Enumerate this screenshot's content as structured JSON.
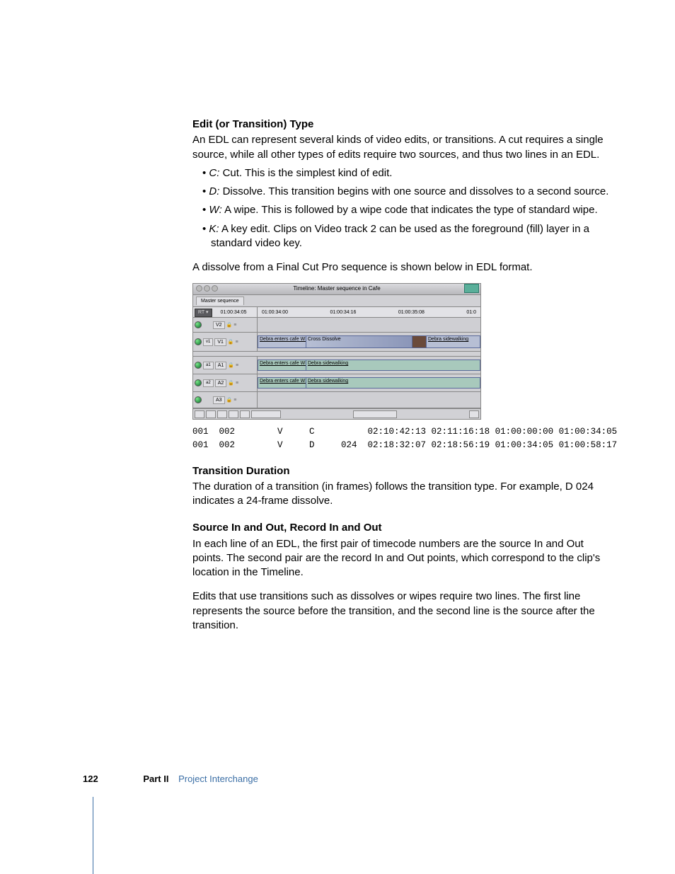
{
  "sections": {
    "editType": {
      "heading": "Edit (or Transition) Type",
      "intro": "An EDL can represent several kinds of video edits, or transitions. A cut requires a single source, while all other types of edits require two sources, and thus two lines in an EDL.",
      "items": [
        {
          "key": "C:",
          "body": "Cut. This is the simplest kind of edit."
        },
        {
          "key": "D:",
          "body": "Dissolve. This transition begins with one source and dissolves to a second source."
        },
        {
          "key": "W:",
          "body": "A wipe. This is followed by a wipe code that indicates the type of standard wipe."
        },
        {
          "key": "K:",
          "body": "A key edit. Clips on Video track 2 can be used as the foreground (fill) layer in a standard video key."
        }
      ],
      "afterList": "A dissolve from a Final Cut Pro sequence is shown below in EDL format."
    },
    "transitionDuration": {
      "heading": "Transition Duration",
      "body": "The duration of a transition (in frames) follows the transition type. For example, D 024 indicates a 24-frame dissolve."
    },
    "sourceIO": {
      "heading": "Source In and Out, Record In and Out",
      "body1": "In each line of an EDL, the first pair of timecode numbers are the source In and Out points. The second pair are the record In and Out points, which correspond to the clip's location in the Timeline.",
      "body2": "Edits that use transitions such as dissolves or wipes require two lines. The first line represents the source before the transition, and the second line is the source after the transition."
    }
  },
  "timeline": {
    "windowTitle": "Timeline: Master sequence in Cafe",
    "tab": "Master sequence",
    "rt": "RT ▾",
    "currentTime": "01:00:34:05",
    "rulerMarks": [
      "01:00:34:00",
      "01:00:34:16",
      "01:00:35:08",
      "01:0"
    ],
    "tracks": {
      "v2": "V2",
      "v1": "V1",
      "v1src": "v1",
      "a1": "A1",
      "a1src": "a1",
      "a2": "A2",
      "a2src": "a2",
      "a3": "A3"
    },
    "clips": {
      "debra_cafe": "Debra enters cafe WS",
      "cross_dissolve": "Cross Dissolve",
      "debra_sidewalk": "Debra sidewalking"
    },
    "lock_glyph": "🔒",
    "bars_glyph": "≡"
  },
  "edl": {
    "line1": "001  002        V     C          02:10:42:13 02:11:16:18 01:00:00:00 01:00:34:05",
    "line2": "001  002        V     D     024  02:18:32:07 02:18:56:19 01:00:34:05 01:00:58:17"
  },
  "footer": {
    "pageNumber": "122",
    "part": "Part II",
    "title": "Project Interchange"
  }
}
